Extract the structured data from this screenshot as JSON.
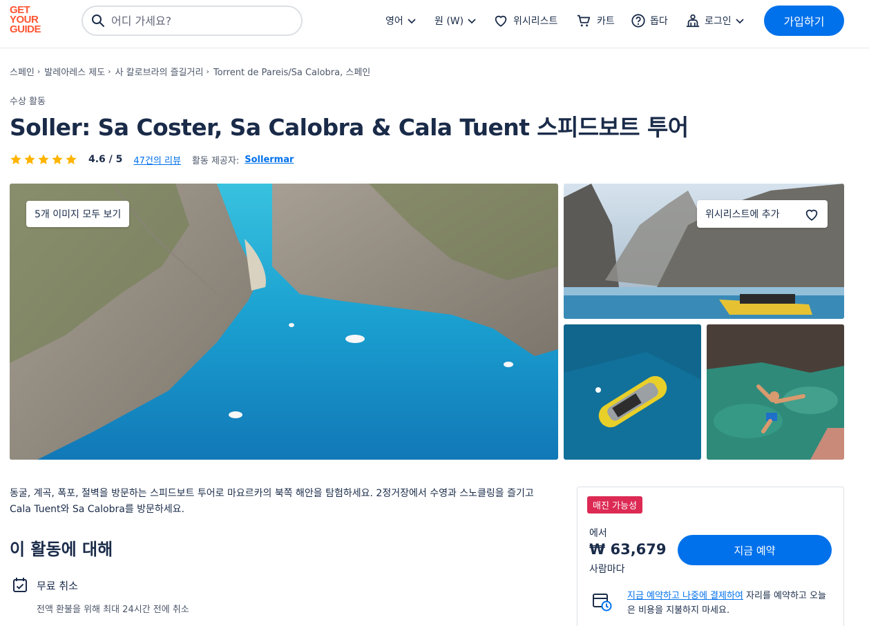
{
  "header": {
    "logo": [
      "GET",
      "YOUR",
      "GUIDE"
    ],
    "search_placeholder": "어디 가세요?",
    "nav": {
      "language": "영어",
      "currency": "원 (W)",
      "wishlist": "위시리스트",
      "cart": "카트",
      "help": "돕다",
      "login": "로그인"
    },
    "signup": "가입하기"
  },
  "breadcrumbs": [
    "스페인",
    "발레아레스 제도",
    "사 칼로브라의 즐길거리",
    "Torrent de Pareis/Sa Calobra, 스페인"
  ],
  "product": {
    "category": "수상 활동",
    "title": "Soller: Sa Coster, Sa Calobra & Cala Tuent 스피드보트 투어",
    "rating": "4.6 / 5",
    "rating_value": 4.6,
    "reviews": "47건의 리뷰",
    "provider_label": "활동 제공자:",
    "provider": "Sollermar"
  },
  "gallery": {
    "view_all": "5개 이미지 모두 보기",
    "add_wishlist": "위시리스트에 추가"
  },
  "description": "동굴, 계곡, 폭포, 절벽을 방문하는 스피드보트 투어로 마요르카의 북쪽 해안을 탐험하세요. 2정거장에서 수영과 스노클링을 즐기고 Cala Tuent와 Sa Calobra를 방문하세요.",
  "about": {
    "heading": "이 활동에 대해",
    "feature_title": "무료 취소",
    "feature_sub": "전액 환불을 위해 최대 24시간 전에 취소"
  },
  "booking": {
    "badge": "매진 가능성",
    "from": "에서",
    "price": "₩ 63,679",
    "per_person": "사람마다",
    "book_button": "지금 예약",
    "rnpl_link": "지금 예약하고 나중에 결제하여",
    "rnpl_text": " 자리를 예약하고 오늘은 비용을 지불하지 마세요."
  },
  "colors": {
    "brand": "#ff5533",
    "primary": "#0071eb",
    "badge": "#dc2a54",
    "star": "#ffb400"
  }
}
